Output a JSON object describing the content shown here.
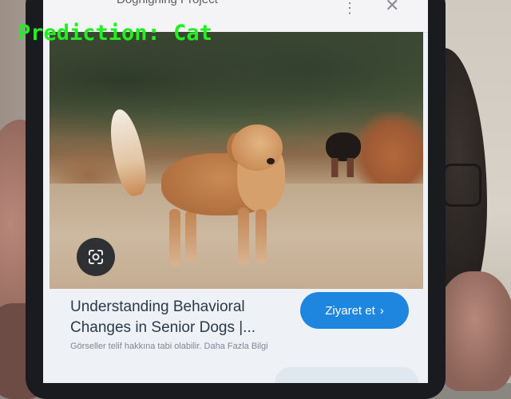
{
  "overlay": {
    "prediction": "Prediction: Cat",
    "color": "#22ee22"
  },
  "phone": {
    "topbar": {
      "title": "Doghighing Project",
      "menu_icon": "kebab-menu-icon",
      "close_icon": "close-icon"
    },
    "image": {
      "lens_icon": "google-lens-icon"
    },
    "result": {
      "title": "Understanding Behavioral Changes in Senior Dogs |...",
      "visit_button": "Ziyaret et",
      "visit_icon": "chevron-right-icon",
      "footnote": "Görseller telif hakkına tabi olabilir. Daha Fazla Bilgi"
    },
    "accent": "#1f86e0"
  }
}
